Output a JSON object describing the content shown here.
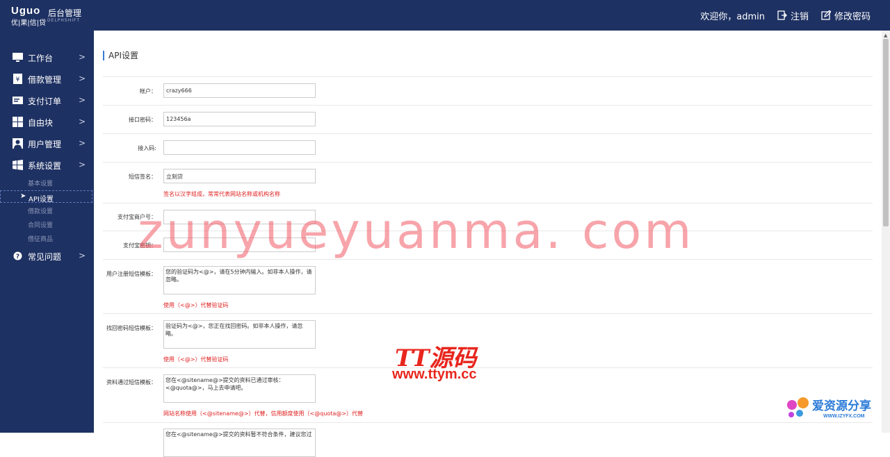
{
  "header": {
    "logo_brand": "Uguo",
    "logo_title": "后台管理",
    "logo_sub": "优|果|信|贷",
    "logo_sub2": "DELPHSHIFT",
    "welcome": "欢迎你，admin",
    "logout": "注销",
    "change_password": "修改密码"
  },
  "sidebar": {
    "items": [
      {
        "label": "工作台",
        "icon": "monitor-icon"
      },
      {
        "label": "借款管理",
        "icon": "loan-icon"
      },
      {
        "label": "支付订单",
        "icon": "order-icon"
      },
      {
        "label": "自由块",
        "icon": "grid-icon"
      },
      {
        "label": "用户管理",
        "icon": "user-icon"
      },
      {
        "label": "系统设置",
        "icon": "windows-icon"
      }
    ],
    "subitems": [
      "基本设置",
      "API设置",
      "借款设置",
      "合同设置",
      "借征商品"
    ],
    "faq": "常见问题"
  },
  "main": {
    "title": "API设置",
    "fields": {
      "account_label": "帐户：",
      "account_value": "crazy666",
      "api_password_label": "接口密码：",
      "api_password_value": "123456a",
      "access_code_label": "接入码:",
      "access_code_value": "",
      "sms_sign_label": "短信签名：",
      "sms_sign_value": "立刻贷",
      "sms_sign_hint": "签名以汉字组成，常常代表网站名称或机构名称",
      "alipay_account_label": "支付宝商户号：",
      "alipay_account_value": "",
      "alipay_key_label": "支付宝密钥：",
      "alipay_key_value": "",
      "register_tpl_label": "用户注册短信模板：",
      "register_tpl_value": "您的验证码为<@>，请在5分钟内输入。如非本人操作，请忽略。",
      "register_tpl_hint": "使用（<@>）代替验证码",
      "findpwd_tpl_label": "找回密码短信模板：",
      "findpwd_tpl_value": "验证码为<@>，您正在找回密码。如非本人操作，请忽略。",
      "findpwd_tpl_hint": "使用（<@>）代替验证码",
      "approve_tpl_label": "资料通过短信模板：",
      "approve_tpl_value": "您在<@sitename@>提交的资料已通过审核：\n<@quota@>，马上去申请吧。",
      "approve_tpl_hint": "网站名称使用（<@sitename@>）代替，信用额度使用（<@quota@>）代替",
      "reject_tpl_value": "您在<@sitename@>提交的资料暂不符合条件，建议您过"
    }
  },
  "watermarks": {
    "big": "zunyueyuanma. com",
    "tt": "TT源码",
    "tt_url": "www.ttym.cc",
    "izy": "爱资源分享",
    "izy_url": "WWW.IZYFX.COM"
  },
  "colors": {
    "nav_bg": "#1e3163",
    "hint_red": "#e02020",
    "accent": "#3a7bd5"
  }
}
